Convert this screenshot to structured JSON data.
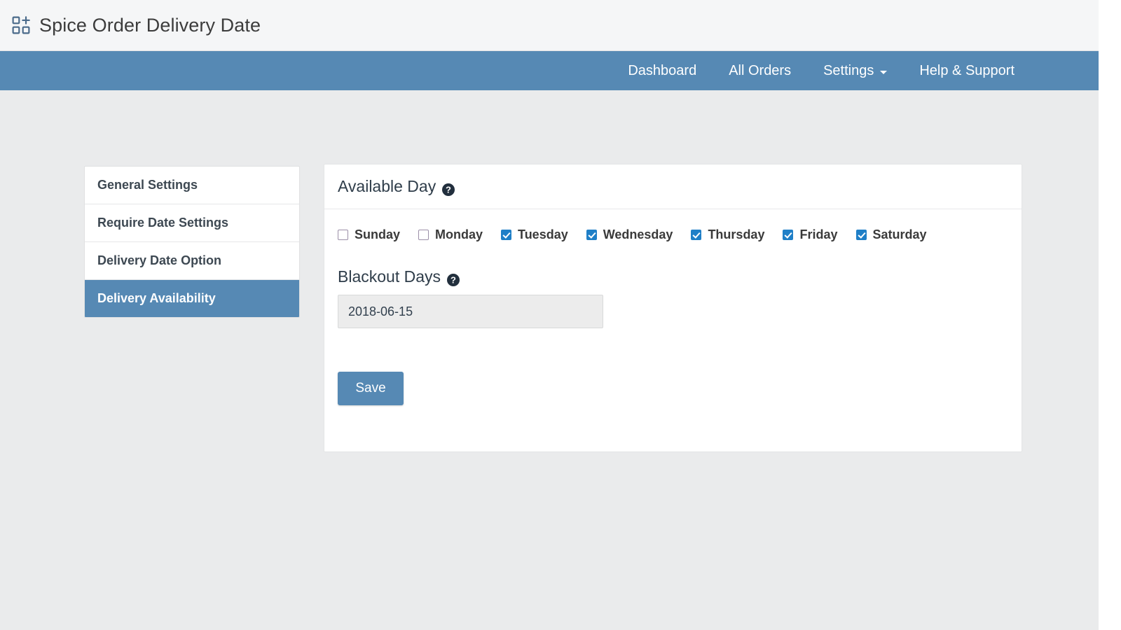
{
  "header": {
    "title": "Spice Order Delivery Date",
    "logo_icon": "grid-plus-icon"
  },
  "nav": {
    "items": [
      {
        "label": "Dashboard",
        "name": "nav-dashboard",
        "caret": false
      },
      {
        "label": "All Orders",
        "name": "nav-all-orders",
        "caret": false
      },
      {
        "label": "Settings",
        "name": "nav-settings",
        "caret": true
      },
      {
        "label": "Help & Support",
        "name": "nav-help-support",
        "caret": false
      }
    ]
  },
  "sidebar": {
    "items": [
      {
        "label": "General Settings",
        "active": false
      },
      {
        "label": "Require Date Settings",
        "active": false
      },
      {
        "label": "Delivery Date Option",
        "active": false
      },
      {
        "label": "Delivery Availability",
        "active": true
      }
    ]
  },
  "card": {
    "available_day": {
      "title": "Available Day",
      "help_icon": "question-circle-icon",
      "days": [
        {
          "label": "Sunday",
          "checked": false
        },
        {
          "label": "Monday",
          "checked": false
        },
        {
          "label": "Tuesday",
          "checked": true
        },
        {
          "label": "Wednesday",
          "checked": true
        },
        {
          "label": "Thursday",
          "checked": true
        },
        {
          "label": "Friday",
          "checked": true
        },
        {
          "label": "Saturday",
          "checked": true
        }
      ]
    },
    "blackout_days": {
      "title": "Blackout Days",
      "help_icon": "question-circle-icon",
      "value": "2018-06-15",
      "placeholder": ""
    },
    "save_label": "Save"
  },
  "colors": {
    "nav_blue": "#5689b4",
    "checkbox_blue": "#1f7fc7",
    "page_bg": "#eaebec",
    "header_bg": "#f5f6f7"
  }
}
